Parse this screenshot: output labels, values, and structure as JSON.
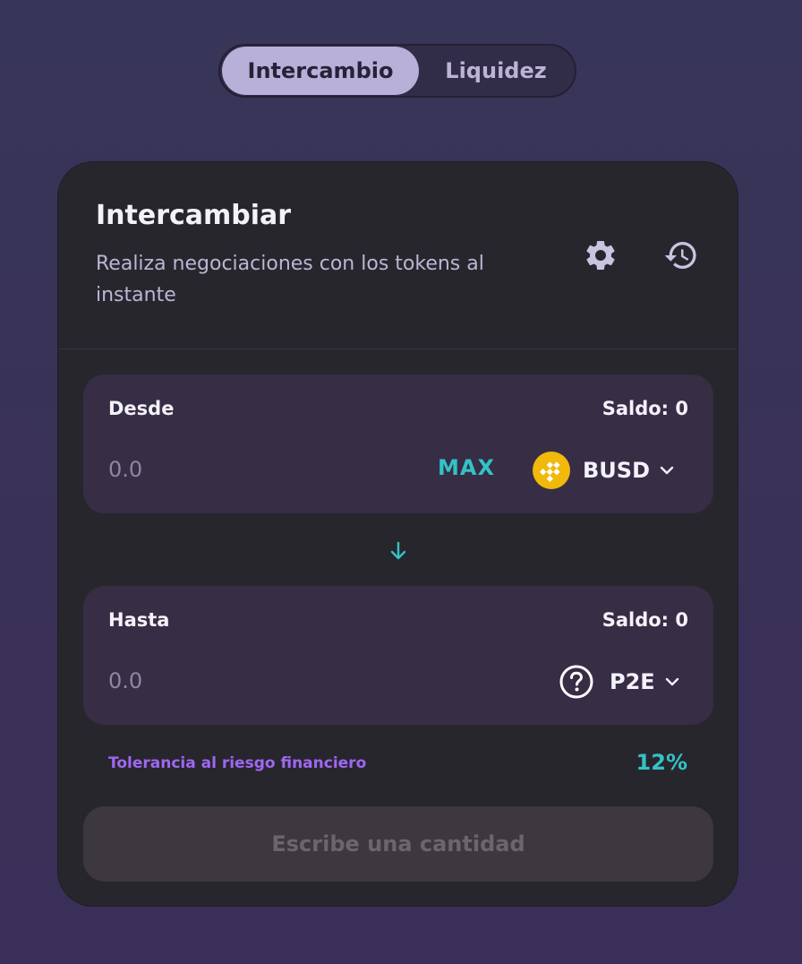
{
  "tabs": [
    {
      "label": "Intercambio",
      "active": true
    },
    {
      "label": "Liquidez",
      "active": false
    }
  ],
  "card": {
    "title": "Intercambiar",
    "subtitle": "Realiza negociaciones con los tokens al instante",
    "icons": {
      "settings": "gear-icon",
      "history": "history-icon"
    }
  },
  "from": {
    "label": "Desde",
    "balance": "Saldo: 0",
    "placeholder": "0.0",
    "max_label": "MAX",
    "token": "BUSD",
    "token_icon": "busd-coin-icon"
  },
  "to": {
    "label": "Hasta",
    "balance": "Saldo: 0",
    "placeholder": "0.0",
    "token": "P2E",
    "token_icon": "question-circle-icon"
  },
  "risk": {
    "label": "Tolerancia al riesgo financiero",
    "value": "12%"
  },
  "submit": {
    "label": "Escribe una cantidad",
    "enabled": false
  },
  "colors": {
    "accent_cyan": "#34c2c6",
    "accent_purple": "#9f67f2",
    "card_bg": "#27262d",
    "panel_bg": "#372d45",
    "tab_active_bg": "#b8b0d8",
    "busd_gold": "#f0b90b"
  }
}
